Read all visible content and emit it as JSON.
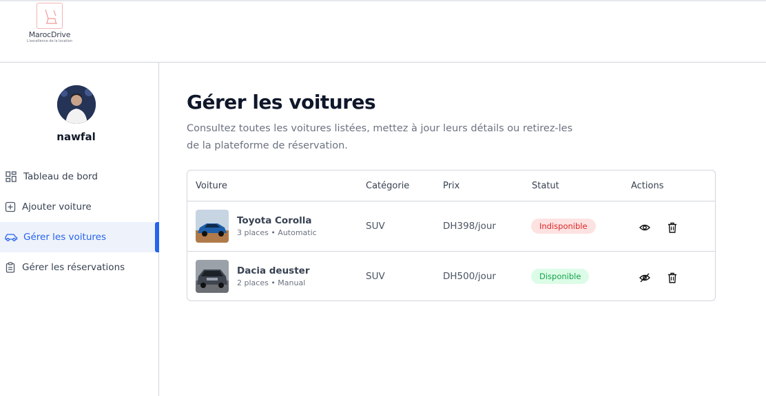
{
  "brand": {
    "name": "MarocDrive",
    "tagline": "L'excellence de la location"
  },
  "user": {
    "name": "nawfal"
  },
  "sidebar": {
    "items": [
      {
        "label": "Tableau de bord",
        "icon": "dashboard-icon"
      },
      {
        "label": "Ajouter voiture",
        "icon": "add-square-icon"
      },
      {
        "label": "Gérer les voitures",
        "icon": "car-icon",
        "active": true
      },
      {
        "label": "Gérer les réservations",
        "icon": "clipboard-icon"
      }
    ]
  },
  "main": {
    "title": "Gérer les voitures",
    "subtitle": "Consultez toutes les voitures listées, mettez à jour leurs détails ou retirez-les de la plateforme de réservation."
  },
  "table": {
    "headers": [
      "Voiture",
      "Catégorie",
      "Prix",
      "Statut",
      "Actions"
    ],
    "rows": [
      {
        "name": "Toyota Corolla",
        "meta": "3 places • Automatic",
        "category": "SUV",
        "price": "DH398/jour",
        "status": "Indisponible",
        "status_color": "#dc2626",
        "visibility_icon": "eye-icon"
      },
      {
        "name": "Dacia deuster",
        "meta": "2 places • Manual",
        "category": "SUV",
        "price": "DH500/jour",
        "status": "Disponible",
        "status_color": "#16a34a",
        "visibility_icon": "eye-off-icon"
      }
    ]
  },
  "colors": {
    "accent": "#2563eb",
    "active_bg": "#eef2fb"
  }
}
